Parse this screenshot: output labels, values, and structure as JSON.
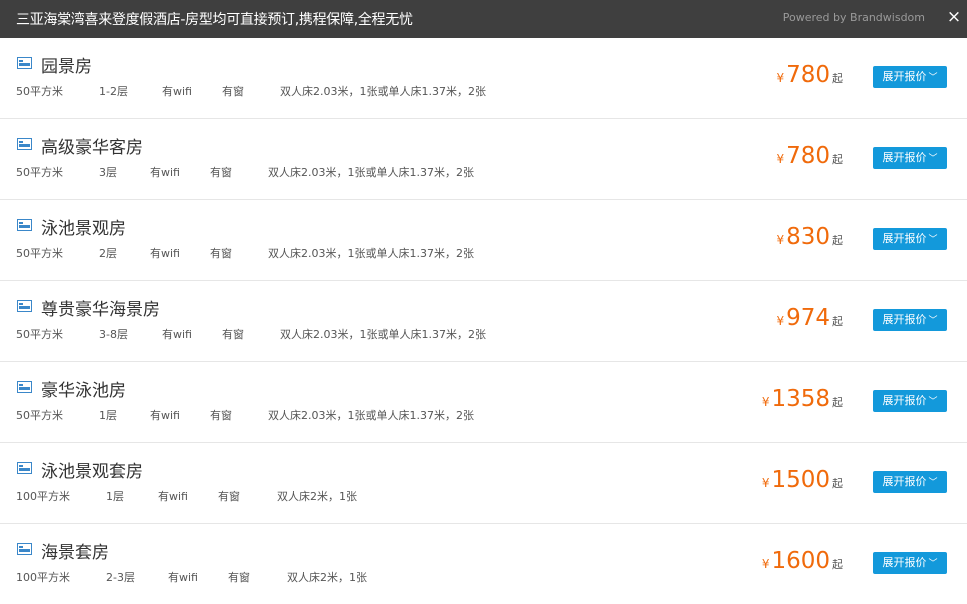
{
  "header": {
    "title": "三亚海棠湾喜来登度假酒店-房型均可直接预订,携程保障,全程无忧",
    "powered_by": "Powered by Brandwisdom",
    "close_icon": "×"
  },
  "accent_colors": {
    "price": "#f06a0b",
    "button": "#1399db",
    "header_bg": "#3f3f3f",
    "icon": "#3a87c9"
  },
  "rooms": [
    {
      "name": "园景房",
      "area": "50平方米",
      "floor": "1-2层",
      "wifi": "有wifi",
      "window": "有窗",
      "bed": "双人床2.03米，1张或单人床1.37米，2张",
      "currency": "¥",
      "price": "780",
      "qi": "起",
      "expand_label": "展开报价"
    },
    {
      "name": "高级豪华客房",
      "area": "50平方米",
      "floor": "3层",
      "wifi": "有wifi",
      "window": "有窗",
      "bed": "双人床2.03米，1张或单人床1.37米，2张",
      "currency": "¥",
      "price": "780",
      "qi": "起",
      "expand_label": "展开报价"
    },
    {
      "name": "泳池景观房",
      "area": "50平方米",
      "floor": "2层",
      "wifi": "有wifi",
      "window": "有窗",
      "bed": "双人床2.03米，1张或单人床1.37米，2张",
      "currency": "¥",
      "price": "830",
      "qi": "起",
      "expand_label": "展开报价"
    },
    {
      "name": "尊贵豪华海景房",
      "area": "50平方米",
      "floor": "3-8层",
      "wifi": "有wifi",
      "window": "有窗",
      "bed": "双人床2.03米，1张或单人床1.37米，2张",
      "currency": "¥",
      "price": "974",
      "qi": "起",
      "expand_label": "展开报价"
    },
    {
      "name": "豪华泳池房",
      "area": "50平方米",
      "floor": "1层",
      "wifi": "有wifi",
      "window": "有窗",
      "bed": "双人床2.03米，1张或单人床1.37米，2张",
      "currency": "¥",
      "price": "1358",
      "qi": "起",
      "expand_label": "展开报价"
    },
    {
      "name": "泳池景观套房",
      "area": "100平方米",
      "floor": "1层",
      "wifi": "有wifi",
      "window": "有窗",
      "bed": "双人床2米，1张",
      "currency": "¥",
      "price": "1500",
      "qi": "起",
      "expand_label": "展开报价"
    },
    {
      "name": "海景套房",
      "area": "100平方米",
      "floor": "2-3层",
      "wifi": "有wifi",
      "window": "有窗",
      "bed": "双人床2米，1张",
      "currency": "¥",
      "price": "1600",
      "qi": "起",
      "expand_label": "展开报价"
    }
  ]
}
